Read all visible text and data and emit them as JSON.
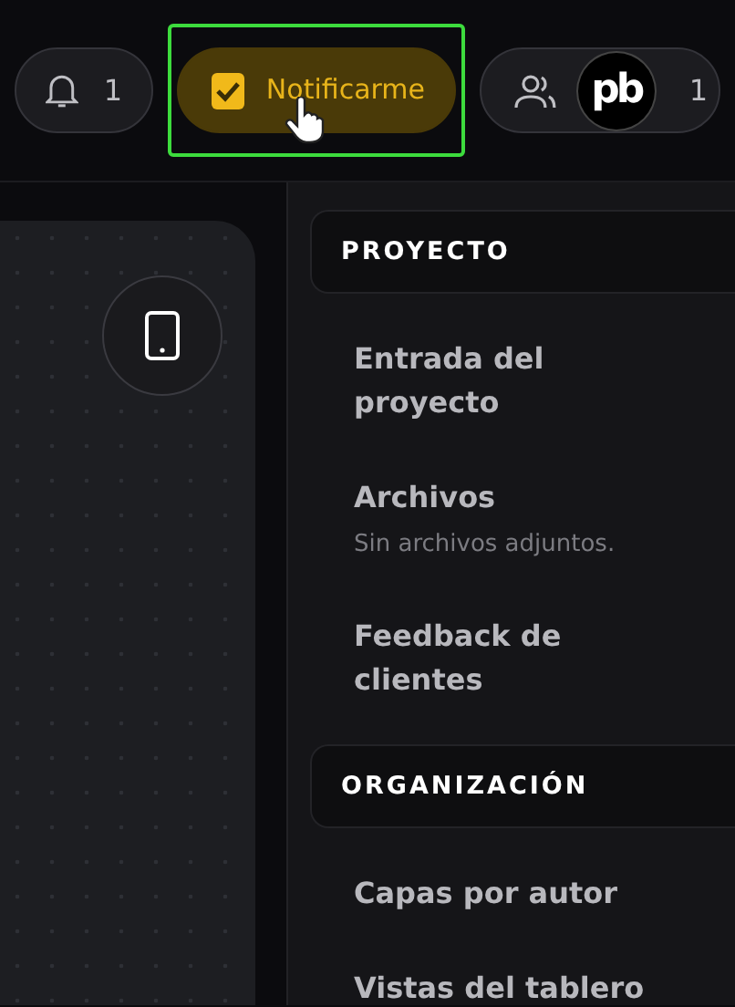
{
  "toolbar": {
    "notifications": {
      "count": "1"
    },
    "notify_toggle": {
      "label": "Notificarme",
      "checked": true,
      "highlighted": true
    },
    "members": {
      "avatar_text": "pb",
      "count": "1"
    }
  },
  "sections": [
    {
      "title": "PROYECTO",
      "items": [
        {
          "label": "Entrada del proyecto"
        },
        {
          "label": "Archivos",
          "subtitle": "Sin archivos adjuntos."
        },
        {
          "label": "Feedback de clientes"
        }
      ]
    },
    {
      "title": "ORGANIZACIÓN",
      "items": [
        {
          "label": "Capas por autor"
        },
        {
          "label": "Vistas del tablero"
        }
      ]
    }
  ]
}
